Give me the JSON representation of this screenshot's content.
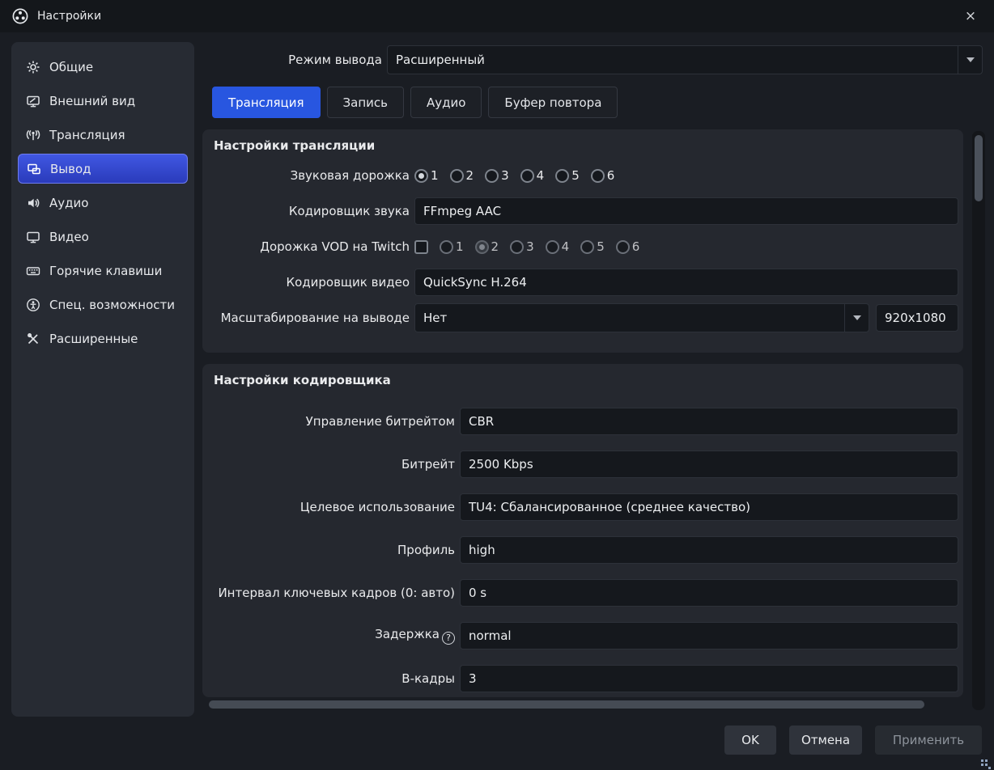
{
  "titlebar": {
    "title": "Настройки",
    "close_icon": "×"
  },
  "colors": {
    "accent_blue": "#2856e0",
    "selected_item_border": "#6e7cee",
    "disabled_text": "#8d939b"
  },
  "sidebar": {
    "items": [
      {
        "label": "Общие",
        "icon": "gear-icon"
      },
      {
        "label": "Внешний вид",
        "icon": "appearance-icon"
      },
      {
        "label": "Трансляция",
        "icon": "broadcast-icon"
      },
      {
        "label": "Вывод",
        "icon": "output-icon",
        "selected": true
      },
      {
        "label": "Аудио",
        "icon": "speaker-icon"
      },
      {
        "label": "Видео",
        "icon": "monitor-icon"
      },
      {
        "label": "Горячие клавиши",
        "icon": "keyboard-icon"
      },
      {
        "label": "Спец. возможности",
        "icon": "accessibility-icon"
      },
      {
        "label": "Расширенные",
        "icon": "tools-icon"
      }
    ]
  },
  "output_mode": {
    "label": "Режим вывода",
    "value": "Расширенный"
  },
  "tabs": {
    "items": [
      {
        "label": "Трансляция",
        "active": true
      },
      {
        "label": "Запись",
        "active": false
      },
      {
        "label": "Аудио",
        "active": false
      },
      {
        "label": "Буфер повтора",
        "active": false
      }
    ]
  },
  "stream_settings": {
    "title": "Настройки трансляции",
    "audio_track": {
      "label": "Звуковая дорожка",
      "options": [
        "1",
        "2",
        "3",
        "4",
        "5",
        "6"
      ],
      "selected": "1"
    },
    "audio_encoder": {
      "label": "Кодировщик звука",
      "value": "FFmpeg AAC"
    },
    "vod_track": {
      "label": "Дорожка VOD на Twitch",
      "checkbox_checked": false,
      "options": [
        "1",
        "2",
        "3",
        "4",
        "5",
        "6"
      ],
      "selected": "2"
    },
    "video_encoder": {
      "label": "Кодировщик видео",
      "value": "QuickSync H.264"
    },
    "rescale": {
      "label": "Масштабирование на выводе",
      "value": "Нет",
      "resolution": "920x1080"
    }
  },
  "encoder_settings": {
    "title": "Настройки кодировщика",
    "rate_control": {
      "label": "Управление битрейтом",
      "value": "CBR"
    },
    "bitrate": {
      "label": "Битрейт",
      "value": "2500 Kbps"
    },
    "target_usage": {
      "label": "Целевое использование",
      "value": "TU4: Сбалансированное (среднее качество)"
    },
    "profile": {
      "label": "Профиль",
      "value": "high"
    },
    "keyint": {
      "label": "Интервал ключевых кадров (0: авто)",
      "value": "0 s"
    },
    "latency": {
      "label": "Задержка",
      "help": "?",
      "value": "normal"
    },
    "bframes": {
      "label": "В-кадры",
      "value": "3"
    }
  },
  "footer": {
    "ok": "OK",
    "cancel": "Отмена",
    "apply": "Применить"
  }
}
